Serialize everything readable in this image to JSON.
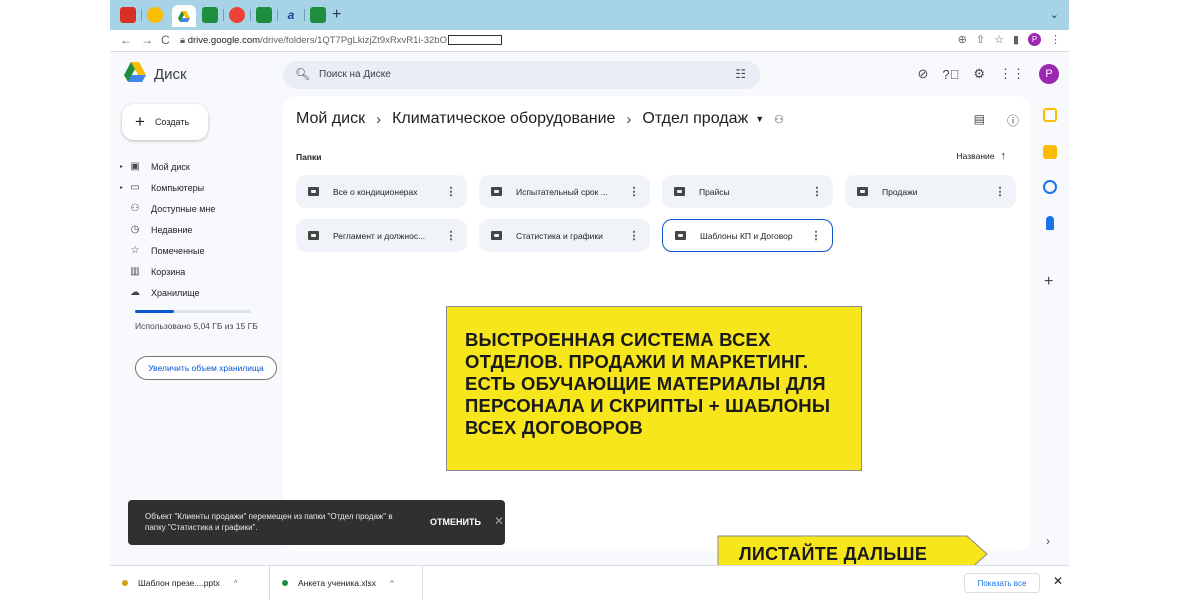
{
  "browser": {
    "url_host": "drive.google.com",
    "url_path": "/drive/folders/1QT7PgLkizjZt9xRxvR1i-32bO",
    "new_tab_label": "+",
    "profile_initial": "P"
  },
  "drive": {
    "app_name": "Диск",
    "search_placeholder": "Поиск на Диске",
    "profile_initial": "P",
    "create_label": "Создать"
  },
  "sidebar": {
    "items": [
      {
        "label": "Мой диск",
        "icon": "my-drive-icon"
      },
      {
        "label": "Компьютеры",
        "icon": "computer-icon"
      },
      {
        "label": "Доступные мне",
        "icon": "shared-icon"
      },
      {
        "label": "Недавние",
        "icon": "clock-icon"
      },
      {
        "label": "Помеченные",
        "icon": "star-icon"
      },
      {
        "label": "Корзина",
        "icon": "trash-icon"
      },
      {
        "label": "Хранилище",
        "icon": "cloud-icon"
      }
    ],
    "quota_text": "Использовано 5,04 ГБ из 15 ГБ",
    "quota_fraction": 0.34,
    "upgrade_label": "Увеличить объем хранилища"
  },
  "breadcrumb": {
    "items": [
      "Мой диск",
      "Климатическое оборудование",
      "Отдел продаж"
    ],
    "separator": "›"
  },
  "section": {
    "folders_label": "Папки",
    "sort_label": "Название"
  },
  "folders": [
    {
      "name": "Все о кондиционерах"
    },
    {
      "name": "Испытательный срок ..."
    },
    {
      "name": "Прайсы"
    },
    {
      "name": "Продажи"
    },
    {
      "name": "Регламент и должнос..."
    },
    {
      "name": "Статистика и графики"
    },
    {
      "name": "Шаблоны КП и Договор",
      "selected": true
    }
  ],
  "overlay": {
    "text": "ВЫСТРОЕННАЯ СИСТЕМА ВСЕХ ОТДЕЛОВ. ПРОДАЖИ И МАРКЕТИНГ. ЕСТЬ ОБУЧАЮЩИЕ МАТЕРИАЛЫ ДЛЯ ПЕРСОНАЛА И СКРИПТЫ + ШАБЛОНЫ ВСЕХ ДОГОВОРОВ",
    "color": "#f7e61b"
  },
  "toast": {
    "message": "Объект \"Клиенты продажи\" перемещен из папки \"Отдел продаж\" в папку \"Статистика и графики\".",
    "undo_label": "ОТМЕНИТЬ",
    "close_label": "✕"
  },
  "next_button": {
    "label": "ЛИСТАЙТЕ ДАЛЬШЕ"
  },
  "downloads": {
    "items": [
      {
        "name": "Шаблон презе....pptx",
        "color": "#d0a010"
      },
      {
        "name": "Анкета ученика.xlsx",
        "color": "#1e8e3e"
      }
    ],
    "show_all_label": "Показать все"
  }
}
